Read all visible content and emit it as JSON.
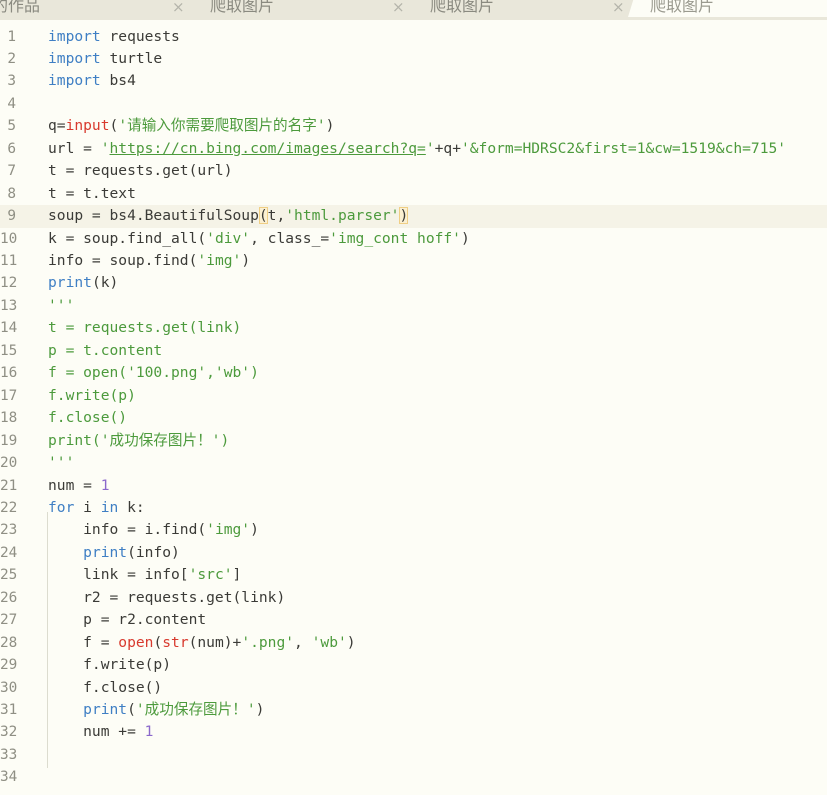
{
  "tabs": [
    {
      "label": "的作品",
      "active": false
    },
    {
      "label": "爬取图片",
      "active": false
    },
    {
      "label": "爬取图片",
      "active": false
    },
    {
      "label": "爬取图片",
      "active": true
    }
  ],
  "tab_close_glyph": "×",
  "current_line": 9,
  "lines": [
    {
      "n": "1",
      "tokens": [
        {
          "t": "import",
          "k": "kw"
        },
        {
          "t": " requests"
        }
      ]
    },
    {
      "n": "2",
      "tokens": [
        {
          "t": "import",
          "k": "kw"
        },
        {
          "t": " turtle"
        }
      ]
    },
    {
      "n": "3",
      "tokens": [
        {
          "t": "import",
          "k": "kw"
        },
        {
          "t": " bs4"
        }
      ]
    },
    {
      "n": "4",
      "tokens": []
    },
    {
      "n": "5",
      "tokens": [
        {
          "t": "q="
        },
        {
          "t": "input",
          "k": "fn"
        },
        {
          "t": "("
        },
        {
          "t": "'请输入你需要爬取图片的名字'",
          "k": "str"
        },
        {
          "t": ")"
        }
      ]
    },
    {
      "n": "6",
      "tokens": [
        {
          "t": "url = "
        },
        {
          "t": "'",
          "k": "str"
        },
        {
          "t": "https://cn.bing.com/images/search?q=",
          "k": "url"
        },
        {
          "t": "'",
          "k": "str"
        },
        {
          "t": "+q+"
        },
        {
          "t": "'&form=HDRSC2&first=1&cw=1519&ch=715'",
          "k": "str"
        }
      ]
    },
    {
      "n": "7",
      "tokens": [
        {
          "t": "t = requests.get(url)"
        }
      ]
    },
    {
      "n": "8",
      "tokens": [
        {
          "t": "t = t.text"
        }
      ]
    },
    {
      "n": "9",
      "tokens": [
        {
          "t": "soup = bs4.BeautifulSoup"
        },
        {
          "t": "(",
          "k": "br"
        },
        {
          "t": "t,"
        },
        {
          "t": "'html.parser'",
          "k": "str"
        },
        {
          "t": ")",
          "k": "br"
        }
      ]
    },
    {
      "n": "10",
      "tokens": [
        {
          "t": "k = soup.find_all("
        },
        {
          "t": "'div'",
          "k": "str"
        },
        {
          "t": ", class_="
        },
        {
          "t": "'img_cont hoff'",
          "k": "str"
        },
        {
          "t": ")"
        }
      ]
    },
    {
      "n": "11",
      "tokens": [
        {
          "t": "info = soup.find("
        },
        {
          "t": "'img'",
          "k": "str"
        },
        {
          "t": ")"
        }
      ]
    },
    {
      "n": "12",
      "tokens": [
        {
          "t": "print",
          "k": "bi"
        },
        {
          "t": "(k)"
        }
      ]
    },
    {
      "n": "13",
      "tokens": [
        {
          "t": "'''",
          "k": "cm"
        }
      ]
    },
    {
      "n": "14",
      "tokens": [
        {
          "t": "t = requests.get(link)",
          "k": "cm"
        }
      ]
    },
    {
      "n": "15",
      "tokens": [
        {
          "t": "p = t.content",
          "k": "cm"
        }
      ]
    },
    {
      "n": "16",
      "tokens": [
        {
          "t": "f = open('100.png','wb')",
          "k": "cm"
        }
      ]
    },
    {
      "n": "17",
      "tokens": [
        {
          "t": "f.write(p)",
          "k": "cm"
        }
      ]
    },
    {
      "n": "18",
      "tokens": [
        {
          "t": "f.close()",
          "k": "cm"
        }
      ]
    },
    {
      "n": "19",
      "tokens": [
        {
          "t": "print('成功保存图片！')",
          "k": "cm"
        }
      ]
    },
    {
      "n": "20",
      "tokens": [
        {
          "t": "'''",
          "k": "cm"
        }
      ]
    },
    {
      "n": "21",
      "tokens": [
        {
          "t": "num = "
        },
        {
          "t": "1",
          "k": "num"
        }
      ]
    },
    {
      "n": "22",
      "tokens": [
        {
          "t": "for",
          "k": "kw"
        },
        {
          "t": " i "
        },
        {
          "t": "in",
          "k": "kw"
        },
        {
          "t": " k:"
        }
      ]
    },
    {
      "n": "23",
      "tokens": [
        {
          "t": "    info = i.find("
        },
        {
          "t": "'img'",
          "k": "str"
        },
        {
          "t": ")"
        }
      ]
    },
    {
      "n": "24",
      "tokens": [
        {
          "t": "    "
        },
        {
          "t": "print",
          "k": "bi"
        },
        {
          "t": "(info)"
        }
      ]
    },
    {
      "n": "25",
      "tokens": [
        {
          "t": "    link = info["
        },
        {
          "t": "'src'",
          "k": "str"
        },
        {
          "t": "]"
        }
      ]
    },
    {
      "n": "26",
      "tokens": [
        {
          "t": "    r2 = requests.get(link)"
        }
      ]
    },
    {
      "n": "27",
      "tokens": [
        {
          "t": "    p = r2.content"
        }
      ]
    },
    {
      "n": "28",
      "tokens": [
        {
          "t": "    f = "
        },
        {
          "t": "open",
          "k": "fn"
        },
        {
          "t": "("
        },
        {
          "t": "str",
          "k": "fn"
        },
        {
          "t": "(num)+"
        },
        {
          "t": "'.png'",
          "k": "str"
        },
        {
          "t": ", "
        },
        {
          "t": "'wb'",
          "k": "str"
        },
        {
          "t": ")"
        }
      ]
    },
    {
      "n": "29",
      "tokens": [
        {
          "t": "    f.write(p)"
        }
      ]
    },
    {
      "n": "30",
      "tokens": [
        {
          "t": "    f.close()"
        }
      ]
    },
    {
      "n": "31",
      "tokens": [
        {
          "t": "    "
        },
        {
          "t": "print",
          "k": "bi"
        },
        {
          "t": "("
        },
        {
          "t": "'成功保存图片！'",
          "k": "str"
        },
        {
          "t": ")"
        }
      ]
    },
    {
      "n": "32",
      "tokens": [
        {
          "t": "    num += "
        },
        {
          "t": "1",
          "k": "num"
        }
      ]
    },
    {
      "n": "33",
      "tokens": []
    },
    {
      "n": "34",
      "tokens": []
    }
  ]
}
